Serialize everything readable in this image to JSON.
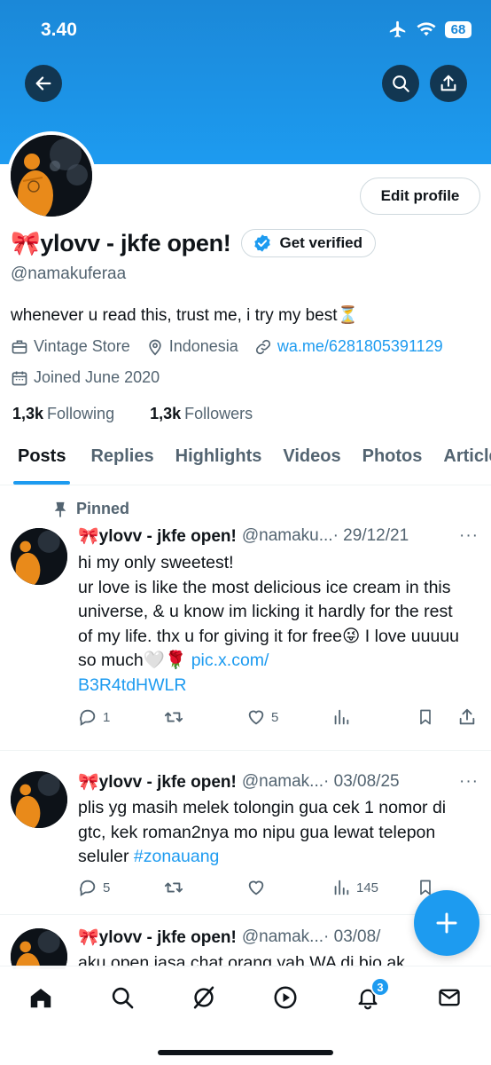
{
  "status_bar": {
    "time": "3.40",
    "battery": "68"
  },
  "profile": {
    "name": "🎀ylovv - jkfe open!",
    "handle": "@namakuferaa",
    "bio": "whenever u read this, trust me, i try my best⏳",
    "category": "Vintage Store",
    "location": "Indonesia",
    "website": "wa.me/6281805391129",
    "joined": "Joined June 2020",
    "following_count": "1,3k",
    "following_label": "Following",
    "followers_count": "1,3k",
    "followers_label": "Followers",
    "edit_profile_label": "Edit profile",
    "get_verified_label": "Get verified"
  },
  "tabs": [
    {
      "label": "Posts",
      "active": true
    },
    {
      "label": "Replies"
    },
    {
      "label": "Highlights"
    },
    {
      "label": "Videos"
    },
    {
      "label": "Photos"
    },
    {
      "label": "Articles"
    }
  ],
  "pinned_label": "Pinned",
  "posts": [
    {
      "name": "🎀ylovv - jkfe open!",
      "handle": "@namaku...",
      "date": "· 29/12/21",
      "text": "hi my only sweetest!\nur love is like the most delicious ice cream in this universe, & u know im licking it hardly for the rest of my life. thx u for giving it for free😜 I love uuuuu so much🤍🌹 ",
      "link": "pic.x.com/\nB3R4tdHWLR",
      "replies": "1",
      "retweets": "",
      "likes": "5",
      "views": ""
    },
    {
      "name": "🎀ylovv - jkfe open!",
      "handle": "@namak...",
      "date": "· 03/08/25",
      "text": "plis yg masih melek tolongin gua cek 1 nomor di gtc, kek roman2nya mo nipu gua lewat telepon seluler ",
      "link": "#zonauang",
      "replies": "5",
      "retweets": "",
      "likes": "",
      "views": "145"
    },
    {
      "name": "🎀ylovv - jkfe open!",
      "handle": "@namak...",
      "date": "· 03/08/",
      "text": "aku open jasa chat orang yah WA di bio ak"
    }
  ],
  "notifications_badge": "3",
  "colors": {
    "accent": "#1d9bf0",
    "text": "#0f1419",
    "muted": "#536471",
    "banner": "#1b88d8"
  }
}
